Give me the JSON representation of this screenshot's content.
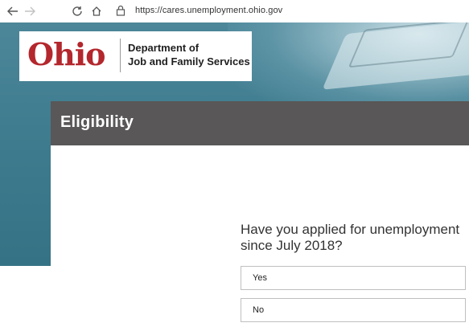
{
  "browser": {
    "url": "https://cares.unemployment.ohio.gov",
    "icons": [
      "back-arrow-icon",
      "forward-arrow-icon",
      "refresh-icon",
      "home-icon",
      "lock-icon"
    ]
  },
  "logo": {
    "wordmark": "Ohio",
    "line1": "Department of",
    "line2": "Job and Family Services"
  },
  "card": {
    "title": "Eligibility",
    "question": "Have you applied for unemployment since July 2018?",
    "options": [
      "Yes",
      "No"
    ]
  },
  "colors": {
    "hero": "#3f7c8f",
    "header": "#595757",
    "ohio_red": "#b3272d"
  }
}
